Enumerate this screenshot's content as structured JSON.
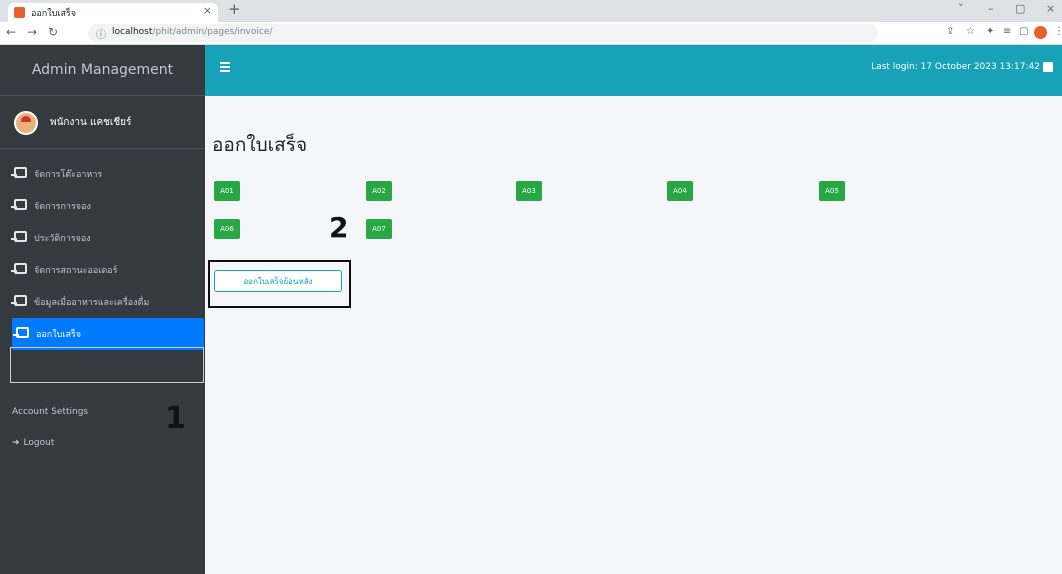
{
  "browser": {
    "tab_title": "ออกใบเสร็จ",
    "tab_close": "×",
    "new_tab": "+",
    "url_host": "localhost",
    "url_path": "/phit/admin/pages/invoice/",
    "window_controls": [
      "˅",
      "–",
      "▢",
      "×"
    ]
  },
  "sidebar": {
    "brand": "Admin Management",
    "user_name": "พนักงาน แคชเชียร์",
    "items": [
      {
        "label": "จัดการโต๊ะอาหาร",
        "icon": "sign-in-icon"
      },
      {
        "label": "จัดการการจอง",
        "icon": "sign-in-icon"
      },
      {
        "label": "ประวัติการจอง",
        "icon": "sign-in-icon"
      },
      {
        "label": "จัดการสถานะออเดอร์",
        "icon": "sign-in-icon"
      },
      {
        "label": "ข้อมูลเมื่ออาหารและเครื่องดื่ม",
        "icon": "sign-in-icon"
      },
      {
        "label": "ออกใบเสร็จ",
        "icon": "sign-in-icon",
        "active": true
      }
    ],
    "account_settings": "Account Settings",
    "logout": "Logout"
  },
  "topbar": {
    "last_login": "Last login: 17 October 2023 13:17:42"
  },
  "main": {
    "title": "ออกใบเสร็จ",
    "tables": [
      "A01",
      "A02",
      "A03",
      "A04",
      "A05",
      "A06",
      "A07"
    ],
    "history_button": "ออกใบเสร็จย้อนหลัง"
  },
  "annotations": {
    "step1": "1",
    "step2": "2"
  },
  "colors": {
    "sidebar_bg": "#343a40",
    "topbar_bg": "#17a2b8",
    "active_item": "#007bff",
    "table_button": "#28a745"
  }
}
